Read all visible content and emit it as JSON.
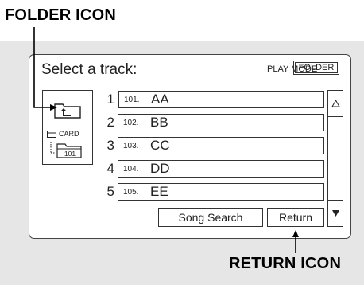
{
  "callouts": {
    "folder_icon": "FOLDER ICON",
    "return_icon": "RETURN ICON"
  },
  "screen": {
    "title": "Select a track:",
    "play_mode_label": "PLAY MODE",
    "folder_button": "FOLDER",
    "card_label": "CARD",
    "folder_number": "101",
    "tracks": [
      {
        "index": "1",
        "prefix": "101.",
        "name": "AA",
        "selected": true
      },
      {
        "index": "2",
        "prefix": "102.",
        "name": "BB",
        "selected": false
      },
      {
        "index": "3",
        "prefix": "103.",
        "name": "CC",
        "selected": false
      },
      {
        "index": "4",
        "prefix": "104.",
        "name": "DD",
        "selected": false
      },
      {
        "index": "5",
        "prefix": "105.",
        "name": "EE",
        "selected": false
      }
    ],
    "song_search_button": "Song Search",
    "return_button": "Return"
  },
  "icons": {
    "up_folder": "folder-up-icon",
    "card": "card-icon",
    "sub_folder": "folder-icon",
    "scroll_up": "triangle-up-icon",
    "scroll_down": "triangle-down-icon"
  },
  "colors": {
    "background_panel": "#e6e6e6",
    "screen": "#ffffff",
    "line": "#333333"
  }
}
